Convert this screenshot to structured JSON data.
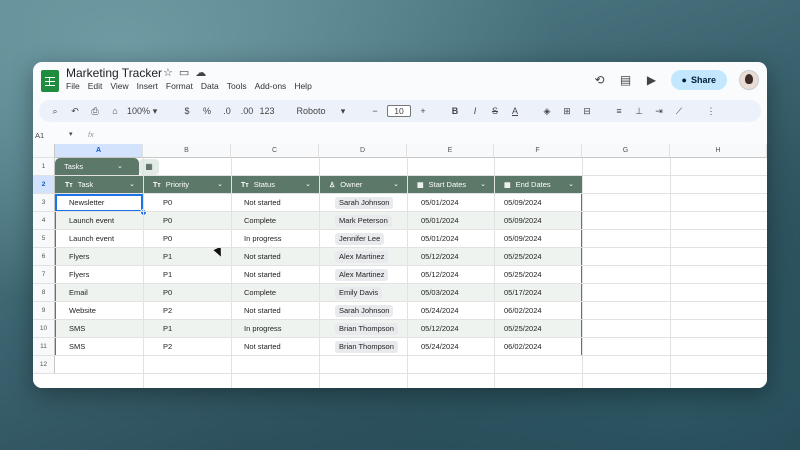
{
  "app": {
    "title": "Marketing Tracker",
    "menu": [
      "File",
      "Edit",
      "View",
      "Insert",
      "Format",
      "Data",
      "Tools",
      "Add-ons",
      "Help"
    ],
    "share_label": "Share"
  },
  "toolbar": {
    "zoom": "100%",
    "currency": "$",
    "percent": "%",
    "decrease_decimal": ".0",
    "increase_decimal": ".00",
    "number_format": "123",
    "font": "Roboto",
    "font_size": "10",
    "bold": "B",
    "italic": "I",
    "strikethrough": "S",
    "text_color": "A"
  },
  "formula_bar": {
    "cell_ref": "A1",
    "fx": "fx"
  },
  "columns": [
    "A",
    "B",
    "C",
    "D",
    "E",
    "F",
    "G",
    "H"
  ],
  "rows": [
    "1",
    "2",
    "3",
    "4",
    "5",
    "6",
    "7",
    "8",
    "9",
    "10",
    "11",
    "12"
  ],
  "table": {
    "name": "Tasks",
    "headers": [
      {
        "label": "Task",
        "icon": "Tт"
      },
      {
        "label": "Priority",
        "icon": "Tт"
      },
      {
        "label": "Status",
        "icon": "Tт"
      },
      {
        "label": "Owner",
        "icon": "person-icon"
      },
      {
        "label": "Start Dates",
        "icon": "calendar-icon"
      },
      {
        "label": "End Dates",
        "icon": "calendar-icon"
      }
    ],
    "rows": [
      {
        "task": "Newsletter",
        "priority": "P0",
        "status": "Not started",
        "owner": "Sarah Johnson",
        "start": "05/01/2024",
        "end": "05/09/2024"
      },
      {
        "task": "Launch event",
        "priority": "P0",
        "status": "Complete",
        "owner": "Mark Peterson",
        "start": "05/01/2024",
        "end": "05/09/2024"
      },
      {
        "task": "Launch event",
        "priority": "P0",
        "status": "In progress",
        "owner": "Jennifer Lee",
        "start": "05/01/2024",
        "end": "05/09/2024"
      },
      {
        "task": "Flyers",
        "priority": "P1",
        "status": "Not started",
        "owner": "Alex Martinez",
        "start": "05/12/2024",
        "end": "05/25/2024"
      },
      {
        "task": "Flyers",
        "priority": "P1",
        "status": "Not started",
        "owner": "Alex Martinez",
        "start": "05/12/2024",
        "end": "05/25/2024"
      },
      {
        "task": "Email",
        "priority": "P0",
        "status": "Complete",
        "owner": "Emily Davis",
        "start": "05/03/2024",
        "end": "05/17/2024"
      },
      {
        "task": "Website",
        "priority": "P2",
        "status": "Not started",
        "owner": "Sarah Johnson",
        "start": "05/24/2024",
        "end": "06/02/2024"
      },
      {
        "task": "SMS",
        "priority": "P1",
        "status": "In progress",
        "owner": "Brian Thompson",
        "start": "05/12/2024",
        "end": "05/25/2024"
      },
      {
        "task": "SMS",
        "priority": "P2",
        "status": "Not started",
        "owner": "Brian Thompson",
        "start": "05/24/2024",
        "end": "06/02/2024"
      }
    ]
  },
  "colors": {
    "table_header": "#5b7868",
    "row_alt": "#eef3ef",
    "selection": "#1a73e8",
    "share_bg": "#c2e7ff"
  }
}
